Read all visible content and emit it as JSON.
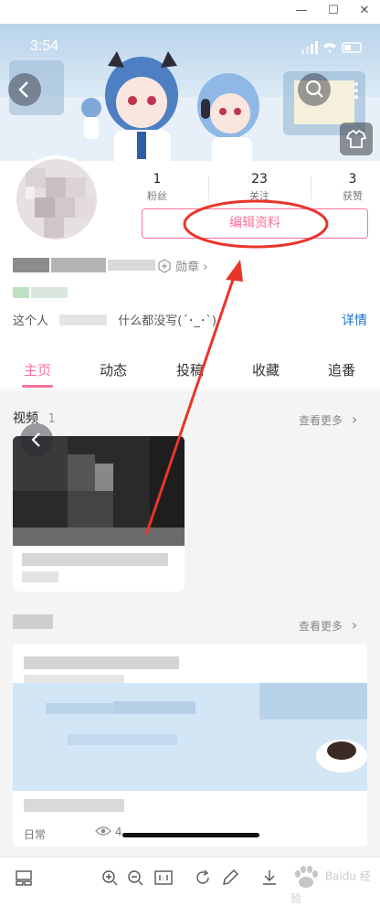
{
  "window": {
    "minimize_icon": "—",
    "maximize_icon": "☐",
    "close_icon": "✕"
  },
  "status_bar": {
    "time": "3:54"
  },
  "stats": [
    {
      "value": "1",
      "label": "粉丝"
    },
    {
      "value": "23",
      "label": "关注"
    },
    {
      "value": "3",
      "label": "获赞"
    }
  ],
  "profile": {
    "edit_button": "编辑资料",
    "medal_label": "勋章",
    "bio_prefix": "这个人",
    "bio_suffix": "什么都没写(´･_･`)",
    "details_link": "详情"
  },
  "tabs": [
    "主页",
    "动态",
    "投稿",
    "收藏",
    "追番"
  ],
  "sections": {
    "videos": {
      "title": "视频",
      "count": "1",
      "more": "查看更多"
    },
    "second": {
      "more": "查看更多"
    }
  },
  "article": {
    "category": "日常",
    "views": "4"
  },
  "annotation": {
    "color": "#e8352a"
  },
  "watermark": "Baidu 经验",
  "colors": {
    "accent": "#fb7299",
    "blue_link": "#1a73c9"
  }
}
